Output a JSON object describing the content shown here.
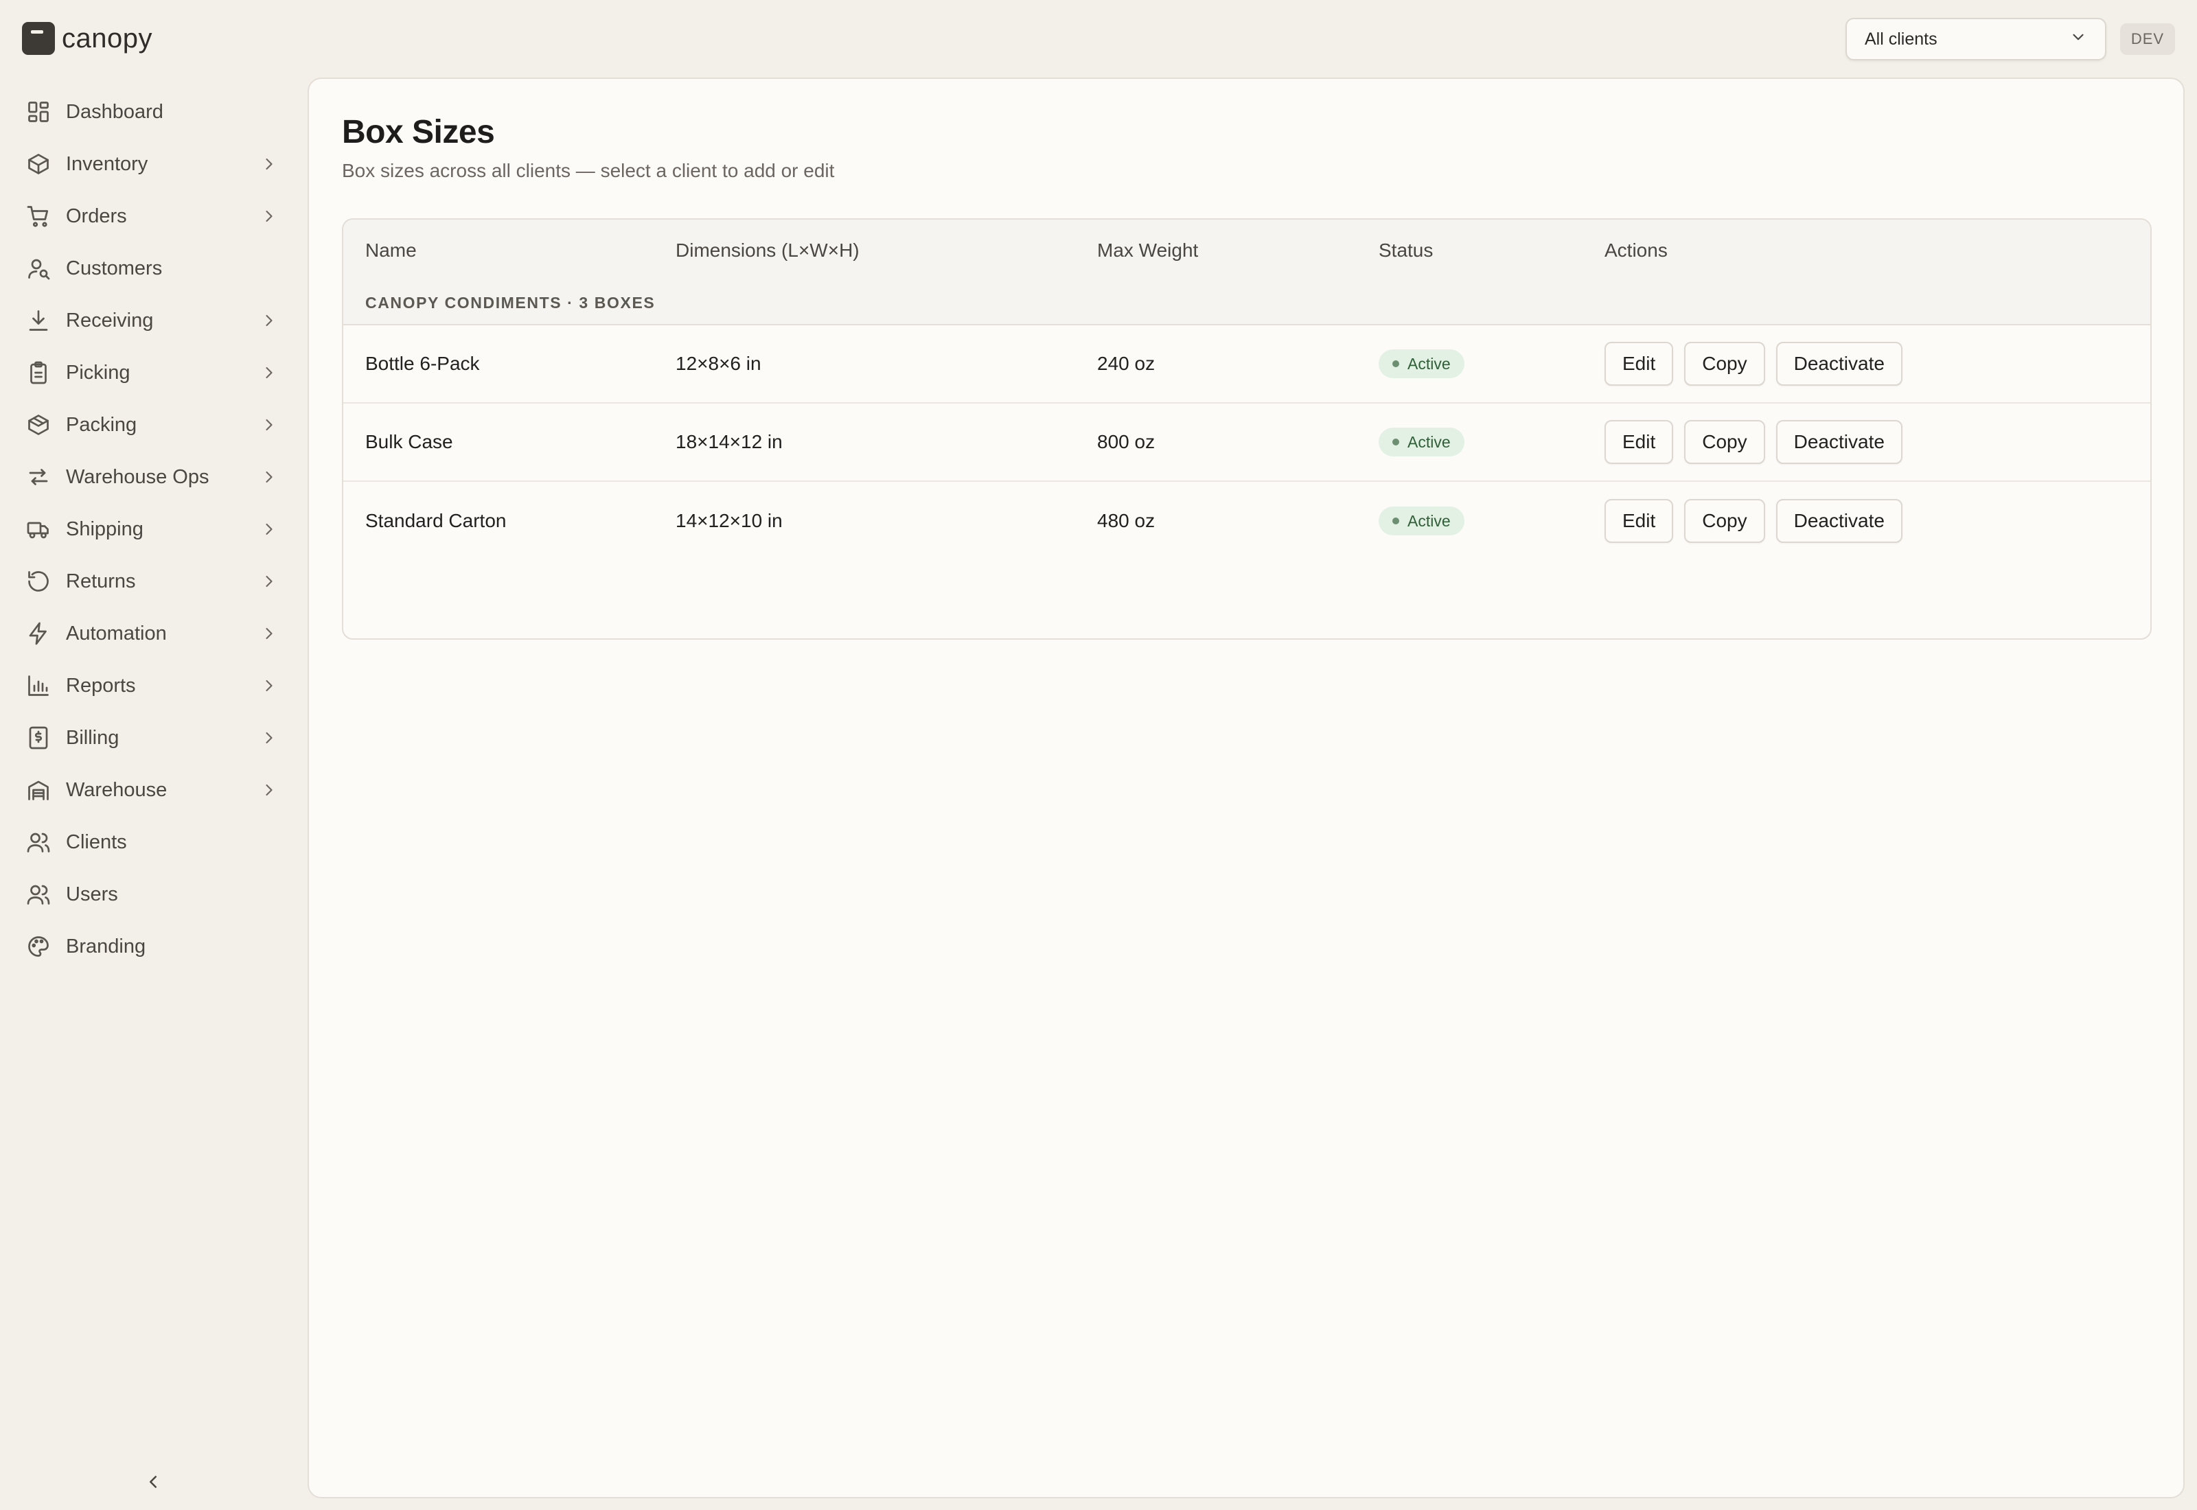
{
  "brand": {
    "name": "canopy"
  },
  "header": {
    "client_select": {
      "value": "All clients"
    },
    "env_badge": "DEV"
  },
  "sidebar": {
    "items": [
      {
        "label": "Dashboard",
        "icon": "dashboard-icon",
        "has_submenu": false
      },
      {
        "label": "Inventory",
        "icon": "box-icon",
        "has_submenu": true
      },
      {
        "label": "Orders",
        "icon": "cart-icon",
        "has_submenu": true
      },
      {
        "label": "Customers",
        "icon": "customer-search-icon",
        "has_submenu": false
      },
      {
        "label": "Receiving",
        "icon": "download-icon",
        "has_submenu": true
      },
      {
        "label": "Picking",
        "icon": "clipboard-icon",
        "has_submenu": true
      },
      {
        "label": "Packing",
        "icon": "package-icon",
        "has_submenu": true
      },
      {
        "label": "Warehouse Ops",
        "icon": "swap-arrows-icon",
        "has_submenu": true
      },
      {
        "label": "Shipping",
        "icon": "truck-icon",
        "has_submenu": true
      },
      {
        "label": "Returns",
        "icon": "rotate-ccw-icon",
        "has_submenu": true
      },
      {
        "label": "Automation",
        "icon": "lightning-icon",
        "has_submenu": true
      },
      {
        "label": "Reports",
        "icon": "bar-chart-icon",
        "has_submenu": true
      },
      {
        "label": "Billing",
        "icon": "invoice-icon",
        "has_submenu": true
      },
      {
        "label": "Warehouse",
        "icon": "warehouse-icon",
        "has_submenu": true
      },
      {
        "label": "Clients",
        "icon": "users-icon",
        "has_submenu": false
      },
      {
        "label": "Users",
        "icon": "users-icon",
        "has_submenu": false
      },
      {
        "label": "Branding",
        "icon": "palette-icon",
        "has_submenu": false
      }
    ]
  },
  "page": {
    "title": "Box Sizes",
    "subtitle": "Box sizes across all clients — select a client to add or edit"
  },
  "table": {
    "columns": [
      "Name",
      "Dimensions (L×W×H)",
      "Max Weight",
      "Status",
      "Actions"
    ],
    "group_label": "CANOPY CONDIMENTS · 3 BOXES",
    "rows": [
      {
        "name": "Bottle 6-Pack",
        "dimensions": "12×8×6 in",
        "max_weight": "240 oz",
        "status": "Active"
      },
      {
        "name": "Bulk Case",
        "dimensions": "18×14×12 in",
        "max_weight": "800 oz",
        "status": "Active"
      },
      {
        "name": "Standard Carton",
        "dimensions": "14×12×10 in",
        "max_weight": "480 oz",
        "status": "Active"
      }
    ],
    "actions": {
      "edit": "Edit",
      "copy": "Copy",
      "deactivate": "Deactivate"
    }
  },
  "colors": {
    "background": "#f3efe9",
    "panel": "#fcfbf8",
    "status_active_bg": "#e3f1e4",
    "status_active_text": "#2f5f37"
  }
}
